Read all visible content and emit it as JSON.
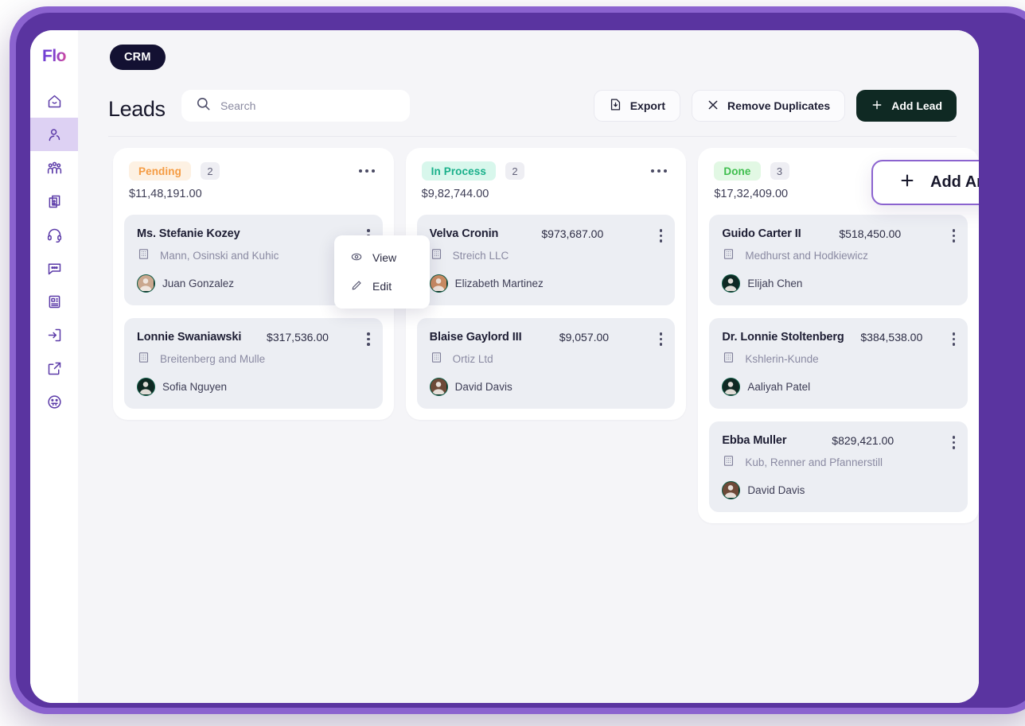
{
  "app": {
    "logo_text": "Flo",
    "crm_pill": "CRM"
  },
  "sidebar": {
    "items": [
      {
        "name": "home-icon",
        "label": "Home",
        "active": false
      },
      {
        "name": "user-icon",
        "label": "Leads",
        "active": true
      },
      {
        "name": "team-icon",
        "label": "Team",
        "active": false
      },
      {
        "name": "invoice-icon",
        "label": "Invoices",
        "active": false
      },
      {
        "name": "headset-icon",
        "label": "Support",
        "active": false
      },
      {
        "name": "chat-icon",
        "label": "Chat",
        "active": false
      },
      {
        "name": "document-icon",
        "label": "Documents",
        "active": false
      },
      {
        "name": "sign-in-icon",
        "label": "Sign In",
        "active": false
      },
      {
        "name": "external-link-icon",
        "label": "External",
        "active": false
      },
      {
        "name": "emoji-icon",
        "label": "Feedback",
        "active": false
      }
    ]
  },
  "header": {
    "title": "Leads",
    "search": {
      "placeholder": "Search",
      "value": ""
    },
    "buttons": {
      "export": "Export",
      "remove_duplicates": "Remove Duplicates",
      "add_lead": "Add Lead"
    }
  },
  "add_status_button": {
    "label": "Add Another Status",
    "icon": "plus-icon"
  },
  "context_menu": {
    "items": [
      {
        "label": "View",
        "icon": "eye-icon"
      },
      {
        "label": "Edit",
        "icon": "pencil-icon"
      }
    ]
  },
  "colors": {
    "frame_outer": "#8b63cf",
    "frame_inner": "#5a34a0",
    "canvas": "#f5f5f8",
    "card_bg": "#eceef3",
    "dark_button": "#0f2923",
    "pill_dark": "#131132",
    "accent_purple": "#8b63cf",
    "pending_text": "#f59b42",
    "pending_bg": "#fdf1e3",
    "in_process_text": "#19b08a",
    "in_process_bg": "#d8f7ec",
    "done_text": "#3fbe4e",
    "done_bg": "#e2f8e4"
  },
  "board": {
    "columns": [
      {
        "status": "Pending",
        "count": "2",
        "total": "$11,48,191.00",
        "badge_text_color": "#f59b42",
        "badge_bg_color": "#fdf1e3",
        "cards": [
          {
            "name": "Ms. Stefanie Kozey",
            "amount": "",
            "company": "Mann, Osinski and Kuhic",
            "owner": "Juan Gonzalez",
            "avatar_tone": "#caa88f"
          },
          {
            "name": "Lonnie Swaniawski",
            "amount": "$317,536.00",
            "company": "Breitenberg and Mulle",
            "owner": "Sofia Nguyen",
            "avatar_tone": "#0f2923"
          }
        ]
      },
      {
        "status": "In Process",
        "count": "2",
        "total": "$9,82,744.00",
        "badge_text_color": "#19b08a",
        "badge_bg_color": "#d8f7ec",
        "cards": [
          {
            "name": "Velva Cronin",
            "amount": "$973,687.00",
            "company": "Streich LLC",
            "owner": "Elizabeth Martinez",
            "avatar_tone": "#c98b63"
          },
          {
            "name": "Blaise Gaylord III",
            "amount": "$9,057.00",
            "company": "Ortiz Ltd",
            "owner": "David Davis",
            "avatar_tone": "#6d4a38"
          }
        ]
      },
      {
        "status": "Done",
        "count": "3",
        "total": "$17,32,409.00",
        "badge_text_color": "#3fbe4e",
        "badge_bg_color": "#e2f8e4",
        "cards": [
          {
            "name": "Guido Carter II",
            "amount": "$518,450.00",
            "company": "Medhurst and Hodkiewicz",
            "owner": "Elijah Chen",
            "avatar_tone": "#0f2923"
          },
          {
            "name": "Dr. Lonnie Stoltenberg",
            "amount": "$384,538.00",
            "company": "Kshlerin-Kunde",
            "owner": "Aaliyah Patel",
            "avatar_tone": "#0f2923"
          },
          {
            "name": "Ebba Muller",
            "amount": "$829,421.00",
            "company": "Kub, Renner and Pfannerstill",
            "owner": "David Davis",
            "avatar_tone": "#6d4a38"
          }
        ]
      }
    ]
  }
}
